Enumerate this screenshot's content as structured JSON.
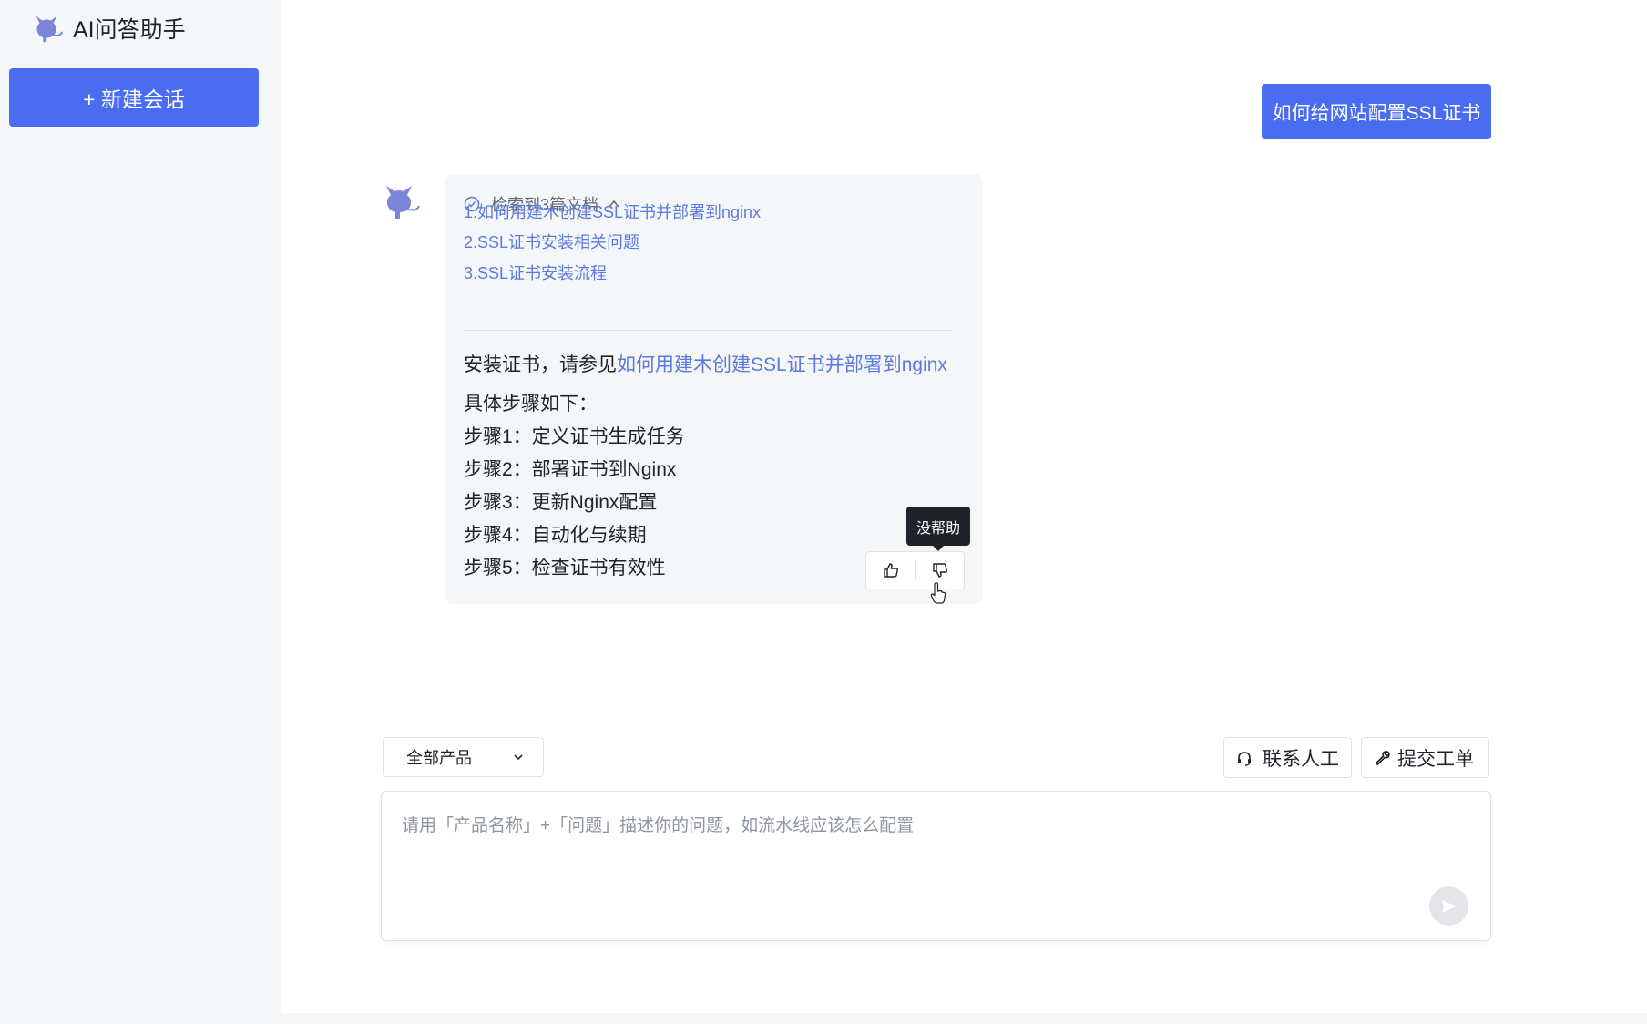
{
  "app": {
    "title": "AI问答助手",
    "new_chat_label": "+ 新建会话"
  },
  "colors": {
    "accent": "#4a6cf0",
    "link": "#5b7ae0",
    "tooltip_bg": "#1f2329"
  },
  "conversation": {
    "user_question": "如何给网站配置SSL证书",
    "retrieval_header": "检索到3篇文档",
    "docs": [
      "1.如何用建木创建SSL证书并部署到nginx",
      "2.SSL证书安装相关问题",
      "3.SSL证书安装流程"
    ],
    "intro_prefix": "安装证书，请参见",
    "intro_link": "如何用建木创建SSL证书并部署到nginx",
    "steps_heading": "具体步骤如下：",
    "steps": [
      "步骤1：定义证书生成任务",
      "步骤2：部署证书到Nginx",
      "步骤3：更新Nginx配置",
      "步骤4：自动化与续期",
      "步骤5：检查证书有效性"
    ],
    "tooltip": "没帮助"
  },
  "composer": {
    "product_select": "全部产品",
    "contact_label": "联系人工",
    "ticket_label": "提交工单",
    "placeholder": "请用「产品名称」+「问题」描述你的问题，如流水线应该怎么配置"
  }
}
